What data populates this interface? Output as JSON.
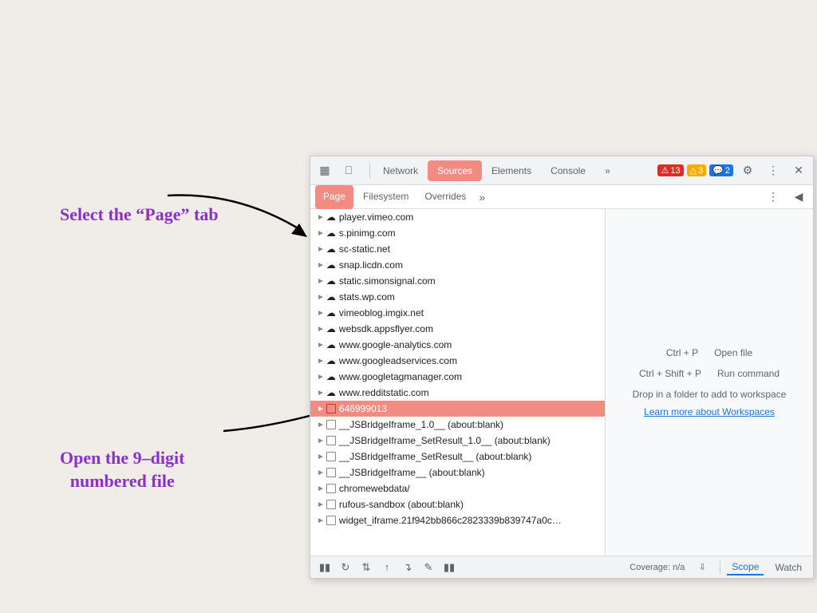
{
  "annotations": {
    "select_page": "Select the “Page” tab",
    "open_file": "Open the 9–digit\nnumbered file"
  },
  "toolbar": {
    "tabs": [
      "Network",
      "Sources",
      "Elements",
      "Console"
    ],
    "active_tab": "Sources",
    "more_label": "»",
    "badges": {
      "error": "13",
      "warn": "3",
      "info": "2"
    },
    "icons": {
      "cursor": "⧆",
      "device": "⎕",
      "settings": "⚙",
      "more": "⋮",
      "close": "✕"
    }
  },
  "subtabs": {
    "items": [
      "Page",
      "Filesystem",
      "Overrides"
    ],
    "active": "Page",
    "more": "»"
  },
  "file_tree": {
    "items": [
      {
        "name": "player.vimeo.com",
        "type": "cloud",
        "indent": 1
      },
      {
        "name": "s.pinimg.com",
        "type": "cloud",
        "indent": 1
      },
      {
        "name": "sc-static.net",
        "type": "cloud",
        "indent": 1
      },
      {
        "name": "snap.licdn.com",
        "type": "cloud",
        "indent": 1
      },
      {
        "name": "static.simonsignal.com",
        "type": "cloud",
        "indent": 1
      },
      {
        "name": "stats.wp.com",
        "type": "cloud",
        "indent": 1
      },
      {
        "name": "vimeoblog.imgix.net",
        "type": "cloud",
        "indent": 1
      },
      {
        "name": "websdk.appsflyer.com",
        "type": "cloud",
        "indent": 1
      },
      {
        "name": "www.google-analytics.com",
        "type": "cloud",
        "indent": 1
      },
      {
        "name": "www.googleadservices.com",
        "type": "cloud",
        "indent": 1
      },
      {
        "name": "www.googletagmanager.com",
        "type": "cloud",
        "indent": 1
      },
      {
        "name": "www.redditstatic.com",
        "type": "cloud",
        "indent": 1
      },
      {
        "name": "646999013",
        "type": "file",
        "indent": 1,
        "highlighted": true
      },
      {
        "name": "__JSBridgeIframe_1.0__ (about:blank)",
        "type": "file",
        "indent": 1
      },
      {
        "name": "__JSBridgeIframe_SetResult_1.0__ (about:blank)",
        "type": "file",
        "indent": 1
      },
      {
        "name": "__JSBridgeIframe_SetResult__ (about:blank)",
        "type": "file",
        "indent": 1
      },
      {
        "name": "__JSBridgeIframe__ (about:blank)",
        "type": "file",
        "indent": 1
      },
      {
        "name": "chromewebdata/",
        "type": "file",
        "indent": 1
      },
      {
        "name": "rufous-sandbox (about:blank)",
        "type": "file",
        "indent": 1
      },
      {
        "name": "widget_iframe.21f942bb866c2823339b839747a0c…",
        "type": "file",
        "indent": 1
      }
    ]
  },
  "right_panel": {
    "shortcut1_key": "Ctrl + P",
    "shortcut1_desc": "Open file",
    "shortcut2_key": "Ctrl + Shift + P",
    "shortcut2_desc": "Run command",
    "workspace_text": "Drop in a folder to add to workspace",
    "workspace_link": "Learn more about Workspaces"
  },
  "bottom_bar": {
    "coverage_label": "Coverage: n/a",
    "scope_label": "Scope",
    "watch_label": "Watch",
    "icons": [
      "⏸",
      "↺",
      "⇆",
      "↕",
      "↴",
      "✎",
      "⏸"
    ]
  }
}
